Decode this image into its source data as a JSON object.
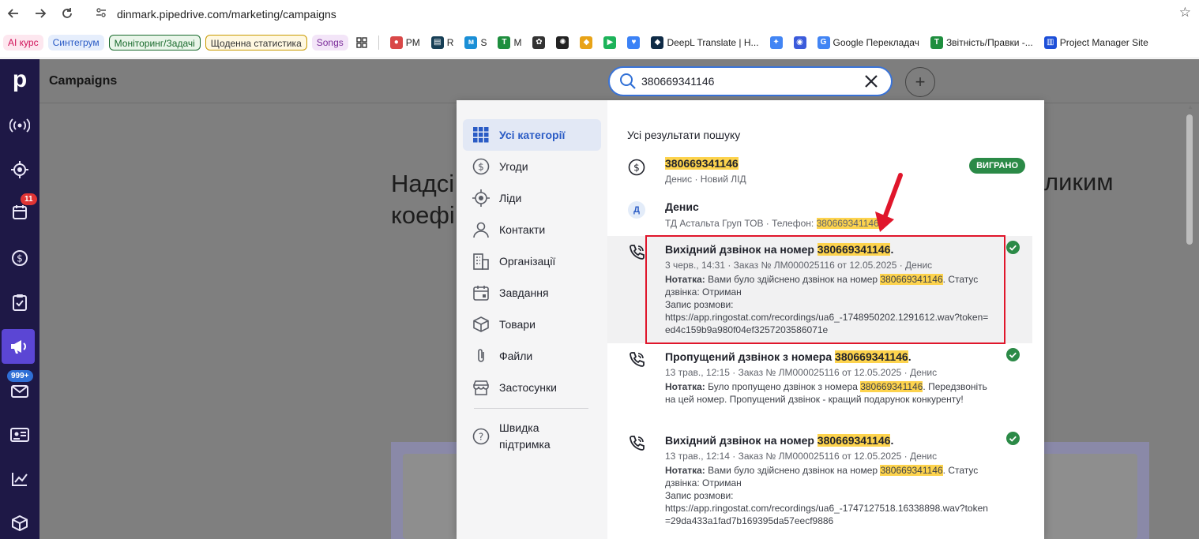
{
  "browser": {
    "url": "dinmark.pipedrive.com/marketing/campaigns",
    "bookmarks": [
      {
        "label": "AI курс",
        "bg": "#fde7ef",
        "color": "#d0145a",
        "border": "none",
        "chip": true
      },
      {
        "label": "Синтегрум",
        "bg": "#e6eefc",
        "color": "#2a5bc5",
        "border": "none",
        "chip": true
      },
      {
        "label": "Моніторинг/Задачі",
        "bg": "#e9f5e9",
        "color": "#186a2c",
        "border": "1px solid #186a2c",
        "chip": true
      },
      {
        "label": "Щоденна статистика",
        "bg": "#fff8e1",
        "color": "#333",
        "border": "1px solid #c99a00",
        "chip": true
      },
      {
        "label": "Songs",
        "bg": "#f3e5f8",
        "color": "#7b2d9a",
        "border": "none",
        "chip": true
      }
    ],
    "bookmark_icons": [
      {
        "label": "PM",
        "icon": "pm-icon",
        "color": "#d94848",
        "glyph": "●"
      },
      {
        "label": "R",
        "icon": "r-icon",
        "color": "#173f56",
        "glyph": "▤"
      },
      {
        "label": "S",
        "icon": "s-icon",
        "color": "#1b8fd6",
        "glyph": "м"
      },
      {
        "label": "M",
        "icon": "m-icon",
        "color": "#1e8e3e",
        "glyph": "T"
      },
      {
        "label": "",
        "icon": "chatgpt-icon",
        "color": "#333",
        "glyph": "✿"
      },
      {
        "label": "",
        "icon": "app-icon",
        "color": "#222",
        "glyph": "✺"
      },
      {
        "label": "",
        "icon": "photos-icon",
        "color": "#e8a317",
        "glyph": "◆"
      },
      {
        "label": "",
        "icon": "play-icon",
        "color": "#1db35a",
        "glyph": "▶"
      },
      {
        "label": "",
        "icon": "heart-icon",
        "color": "#3b82f6",
        "glyph": "♥"
      },
      {
        "label": "DeepL Translate | H...",
        "icon": "deepl-icon",
        "color": "#0f2b46",
        "glyph": "◆"
      },
      {
        "label": "",
        "icon": "gemini-icon",
        "color": "#4285f4",
        "glyph": "✦"
      },
      {
        "label": "",
        "icon": "copilot-icon",
        "color": "#3b5bdb",
        "glyph": "◉"
      },
      {
        "label": "Google Перекладач",
        "icon": "google-translate-icon",
        "color": "#4285f4",
        "glyph": "G"
      },
      {
        "label": "Звітність/Правки -...",
        "icon": "sheets-icon",
        "color": "#1e8e3e",
        "glyph": "T"
      },
      {
        "label": "Project Manager Site",
        "icon": "trello-icon",
        "color": "#1d4fd8",
        "glyph": "▥"
      }
    ]
  },
  "app": {
    "page_title": "Campaigns",
    "bg_heading_line1": "Надсі",
    "bg_heading_line2": "коефі",
    "bg_heading_right": "ликим",
    "calendar_badge": "11",
    "mail_badge": "999+"
  },
  "search": {
    "query": "380669341146"
  },
  "categories": [
    {
      "label": "Усі категорії",
      "icon": "grid-icon",
      "active": true
    },
    {
      "label": "Угоди",
      "icon": "dollar-icon"
    },
    {
      "label": "Ліди",
      "icon": "target-icon"
    },
    {
      "label": "Контакти",
      "icon": "person-icon"
    },
    {
      "label": "Організації",
      "icon": "building-icon"
    },
    {
      "label": "Завдання",
      "icon": "calendar-icon"
    },
    {
      "label": "Товари",
      "icon": "box-icon"
    },
    {
      "label": "Файли",
      "icon": "paperclip-icon"
    },
    {
      "label": "Застосунки",
      "icon": "store-icon"
    }
  ],
  "support_label_1": "Швидка",
  "support_label_2": "підтримка",
  "results": {
    "title": "Усі результати пошуку",
    "deal": {
      "title": "380669341146",
      "sub": "Денис  ·  Новий ЛІД",
      "status": "ВИГРАНО"
    },
    "contact": {
      "avatar": "Д",
      "title": "Денис",
      "sub_prefix": "ТД Астальта Груп ТОВ  ·  Телефон: ",
      "sub_phone": "380669341146"
    },
    "calls": [
      {
        "title_prefix": "Вихідний дзвінок на номер ",
        "number": "380669341146",
        "meta": "3 черв., 14:31  ·  Заказ № ЛМ000025116 от 12.05.2025  ·  Денис",
        "note_label": "Нотатка:",
        "note_pre": " Вами було здійснено дзвінок на номер ",
        "note_post": ". Статус дзвінка: Отриман",
        "rec_label": "Запис розмови:",
        "rec_url": "https://app.ringostat.com/recordings/ua6_-1748950202.1291612.wav?token=ed4c159b9a980f04ef3257203586071e"
      },
      {
        "title_prefix": "Пропущений дзвінок з номера ",
        "number": "380669341146",
        "meta": "13 трав., 12:15  ·  Заказ № ЛМ000025116 от 12.05.2025  ·  Денис",
        "note_label": "Нотатка:",
        "note_pre": " Було пропущено дзвінок з номера ",
        "note_post": ". Передзвоніть на цей номер. Пропущений дзвінок - кращий подарунок конкуренту!"
      },
      {
        "title_prefix": "Вихідний дзвінок на номер ",
        "number": "380669341146",
        "meta": "13 трав., 12:14  ·  Заказ № ЛМ000025116 от 12.05.2025  ·  Денис",
        "note_label": "Нотатка:",
        "note_pre": " Вами було здійснено дзвінок на номер ",
        "note_post": ". Статус дзвінка: Отриман",
        "rec_label": "Запис розмови:",
        "rec_url": "https://app.ringostat.com/recordings/ua6_-1747127518.16338898.wav?token=29da433a1fad7b169395da57eecf9886"
      }
    ]
  },
  "colors": {
    "accent": "#3973d8",
    "nav_bg": "#1e1846",
    "nav_active": "#5b46d4",
    "highlight": "#fdd34d",
    "won": "#2b8a47",
    "annotation": "#e0162b"
  }
}
